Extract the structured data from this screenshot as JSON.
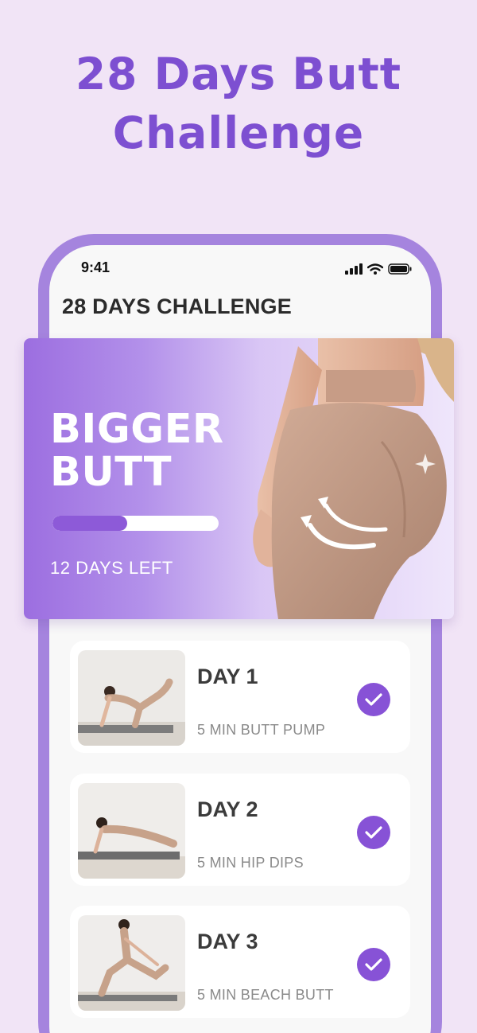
{
  "headline": {
    "line1": "28 Days Butt",
    "line2": "Challenge"
  },
  "status_bar": {
    "time": "9:41",
    "icons": [
      "signal-icon",
      "wifi-icon",
      "battery-icon"
    ]
  },
  "app": {
    "title": "28 DAYS CHALLENGE"
  },
  "banner": {
    "title_line1": "BIGGER",
    "title_line2": "BUTT",
    "progress_fraction": 0.45,
    "days_left": "12 DAYS LEFT"
  },
  "days": [
    {
      "title": "DAY 1",
      "subtitle": "5 MIN BUTT PUMP",
      "completed": true
    },
    {
      "title": "DAY 2",
      "subtitle": "5 MIN HIP DIPS",
      "completed": true
    },
    {
      "title": "DAY 3",
      "subtitle": "5 MIN BEACH BUTT",
      "completed": true
    }
  ],
  "colors": {
    "background": "#f1e4f6",
    "accent": "#7d4fd1",
    "phone_frame": "#a584de",
    "check": "#8752d6",
    "progress_fill": "#8d5ad8"
  }
}
